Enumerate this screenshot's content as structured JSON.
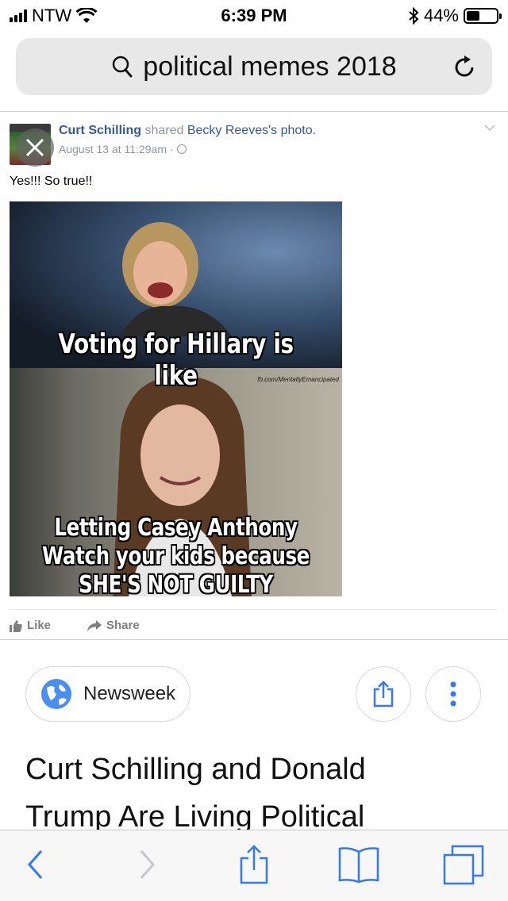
{
  "status_bar": {
    "carrier": "NTW",
    "time": "6:39 PM",
    "battery_percent": "44%",
    "battery_level": 0.44
  },
  "address_bar": {
    "query": "political memes 2018"
  },
  "post": {
    "author": "Curt Schilling",
    "shared_text": "shared",
    "shared_from": "Becky Reeves",
    "shared_suffix": "'s photo.",
    "timestamp": "August 13 at 11:29am",
    "dot": "·",
    "text": "Yes!!! So true!!",
    "meme": {
      "caption_top": "Voting for Hillary is like",
      "watermark": "fb.com/MentallyEmancipated",
      "caption_bottom_1": "Letting Casey Anthony",
      "caption_bottom_2": "Watch your kids because",
      "caption_bottom_3": "SHE'S NOT GUILTY"
    },
    "like_label": "Like",
    "share_label": "Share"
  },
  "source": {
    "name": "Newsweek"
  },
  "headline": {
    "line1": "Curt Schilling and Donald",
    "line2": "Trump Are Living Political"
  },
  "colors": {
    "link": "#365899",
    "ios_blue": "#3478f6",
    "chip_globe": "#4b8ef1"
  }
}
